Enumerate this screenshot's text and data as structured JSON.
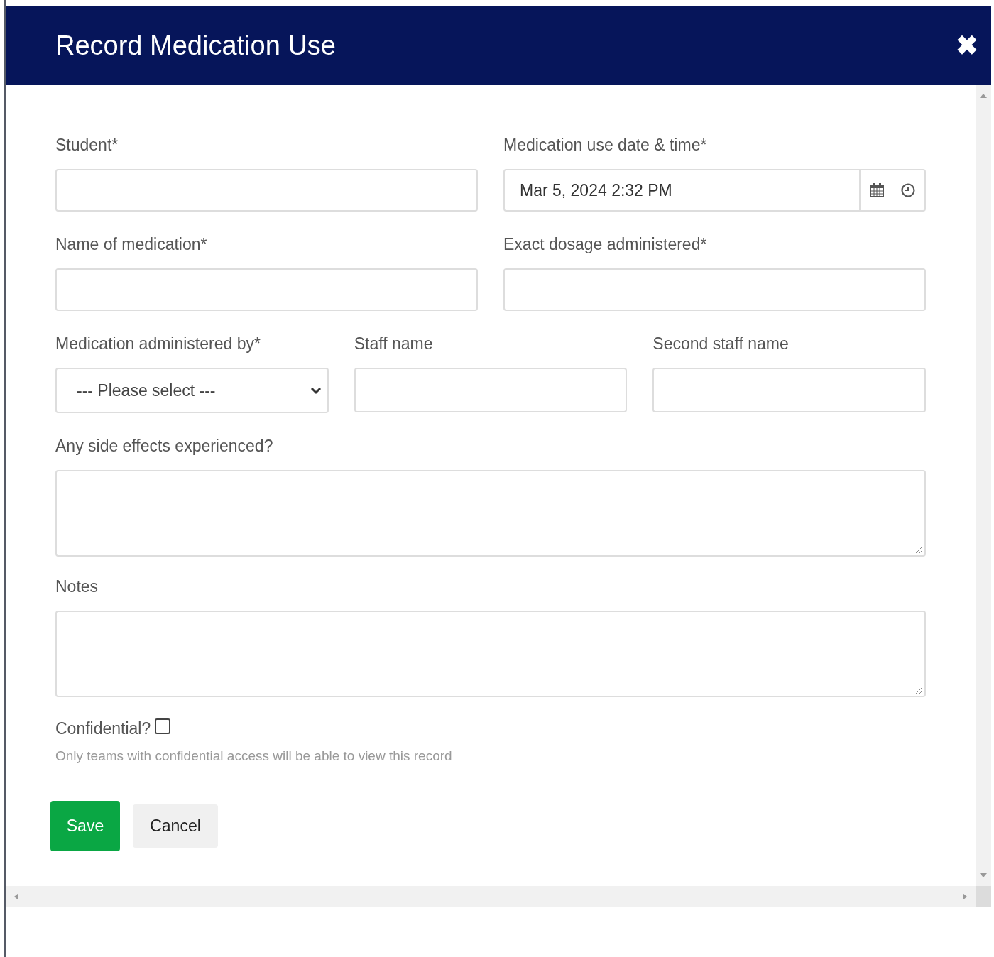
{
  "dialog": {
    "title": "Record Medication Use",
    "close": "✖"
  },
  "rows": [
    [
      {
        "label": "Student*",
        "kind": "text"
      },
      {
        "label": "Medication use date & time*",
        "kind": "datetime",
        "value": "Mar 5, 2024 2:32 PM"
      }
    ],
    [
      {
        "label": "Name of medication*",
        "kind": "text"
      },
      {
        "label": "Exact dosage administered*",
        "kind": "text"
      }
    ],
    [
      {
        "label": "Medication administered by*",
        "kind": "select",
        "value": "--- Please select ---"
      },
      {
        "label": "Staff name",
        "kind": "text"
      },
      {
        "label": "Second staff name",
        "kind": "text"
      }
    ],
    [
      {
        "label": "Any side effects experienced?",
        "kind": "textarea"
      }
    ],
    [
      {
        "label": "Notes",
        "kind": "textarea"
      }
    ]
  ],
  "confidential": {
    "label": "Confidential?",
    "checked": false,
    "help": "Only teams with confidential access will be able to view this record"
  },
  "buttons": [
    {
      "label": "Save",
      "kind": "primary"
    },
    {
      "label": "Cancel",
      "kind": "secondary"
    }
  ]
}
